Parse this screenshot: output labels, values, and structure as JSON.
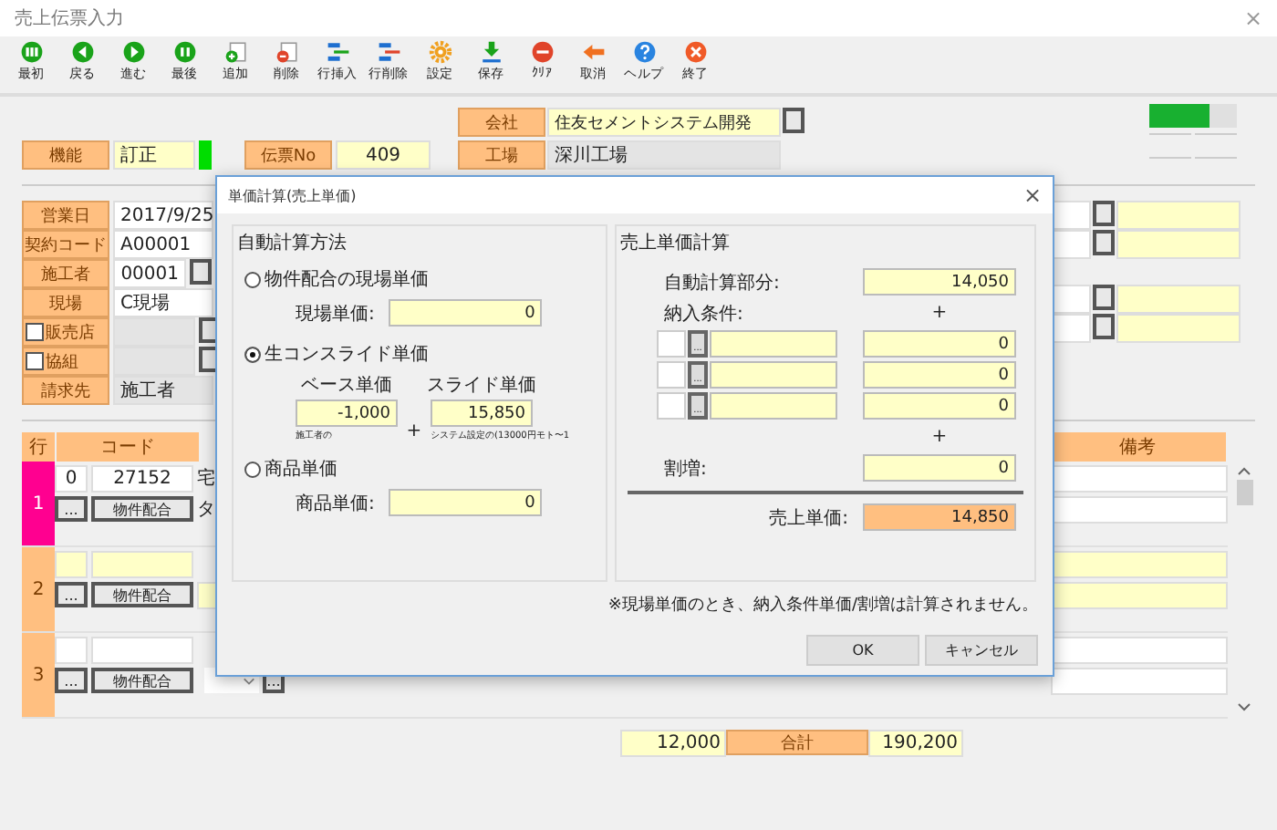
{
  "window": {
    "title": "売上伝票入力",
    "close": "×"
  },
  "toolbar": [
    {
      "label": "最初",
      "kind": "first"
    },
    {
      "label": "戻る",
      "kind": "prev"
    },
    {
      "label": "進む",
      "kind": "next"
    },
    {
      "label": "最後",
      "kind": "last"
    },
    {
      "label": "追加",
      "kind": "add"
    },
    {
      "label": "削除",
      "kind": "delete"
    },
    {
      "label": "行挿入",
      "kind": "row-insert"
    },
    {
      "label": "行削除",
      "kind": "row-delete"
    },
    {
      "label": "設定",
      "kind": "settings"
    },
    {
      "label": "保存",
      "kind": "save"
    },
    {
      "label": "ｸﾘｱ",
      "kind": "clear"
    },
    {
      "label": "取消",
      "kind": "cancel"
    },
    {
      "label": "ヘルプ",
      "kind": "help"
    },
    {
      "label": "終了",
      "kind": "exit"
    }
  ],
  "header": {
    "function_label": "機能",
    "function_value": "訂正",
    "slip_label": "伝票No",
    "slip_value": "409",
    "company_label": "会社",
    "company_value": "住友セメントシステム開発",
    "plant_label": "工場",
    "plant_value": "深川工場",
    "meter": {
      "level": 0.68
    }
  },
  "form": [
    {
      "kind": "text",
      "label": "営業日",
      "value": "2017/9/25"
    },
    {
      "kind": "text",
      "label": "契約コード",
      "value": "A00001"
    },
    {
      "kind": "lookup",
      "label": "施工者",
      "value": "00001"
    },
    {
      "kind": "text",
      "label": "現場",
      "value": "C現場"
    },
    {
      "kind": "check",
      "label": "販売店",
      "checked": false
    },
    {
      "kind": "check",
      "label": "協組",
      "checked": false
    },
    {
      "kind": "select",
      "label": "請求先",
      "value": "施工者"
    }
  ],
  "grid": {
    "columns": [
      "行",
      "コード",
      "備考"
    ],
    "rows": [
      {
        "number": "1",
        "selected": true,
        "highlighted": false,
        "column_1": "0",
        "code": "27152",
        "column_3": "宅",
        "lookup": "...",
        "button": "物件配合",
        "column_3b": "タ"
      },
      {
        "number": "2",
        "selected": false,
        "highlighted": true,
        "lookup": "...",
        "button": "物件配合"
      },
      {
        "number": "3",
        "selected": false,
        "highlighted": false,
        "lookup": "...",
        "button": "物件配合",
        "extra_lookup": "..."
      }
    ],
    "totals": {
      "quantity": "12,000",
      "label": "合計",
      "amount": "190,200"
    }
  },
  "dialog": {
    "title": "単価計算(売上単価)",
    "close": "×",
    "method_title": "自動計算方法",
    "methods": [
      {
        "kind": "single",
        "label": "物件配合の現場単価",
        "selected": false,
        "field_label": "現場単価:",
        "value": "0"
      },
      {
        "kind": "slide",
        "label": "生コンスライド単価",
        "selected": true,
        "base_label": "ベース単価",
        "base_value": "-1,000",
        "base_note": "施工者の",
        "plus": "+",
        "slide_label": "スライド単価",
        "slide_value": "15,850",
        "slide_note": "システム設定の(13000円モト〜1"
      },
      {
        "kind": "single",
        "label": "商品単価",
        "selected": false,
        "field_label": "商品単価:",
        "value": "0"
      }
    ],
    "calc_title": "売上単価計算",
    "auto_label": "自動計算部分:",
    "auto_value": "14,050",
    "plus_1": "+",
    "conditions_label": "納入条件:",
    "conditions": [
      {
        "button": "...",
        "value": "0"
      },
      {
        "button": "...",
        "value": "0"
      },
      {
        "button": "...",
        "value": "0"
      }
    ],
    "plus_2": "+",
    "surcharge_label": "割増:",
    "surcharge_value": "0",
    "total_label": "売上単価:",
    "total_value": "14,850",
    "note": "※現場単価のとき、納入条件単価/割増は計算されません。",
    "buttons": [
      "OK",
      "キャンセル"
    ]
  }
}
